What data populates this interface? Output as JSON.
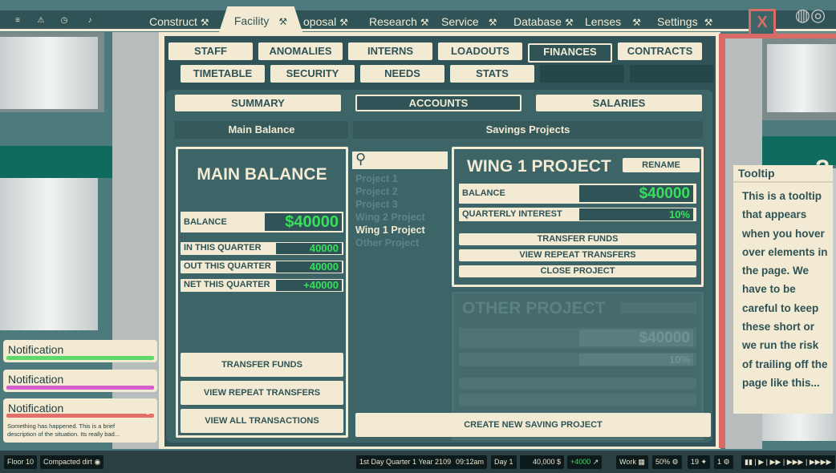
{
  "top_nav": {
    "sys_icons": [
      "menu-icon",
      "warning-icon",
      "clock-icon",
      "bell-icon"
    ],
    "tabs": [
      {
        "label": "Construct",
        "icon": "⚒"
      },
      {
        "label": "Facility",
        "icon": "⚒"
      },
      {
        "label": "oposal",
        "icon": "⚒"
      },
      {
        "label": "Research",
        "icon": "⚒"
      },
      {
        "label": "Service",
        "icon": "⚒"
      },
      {
        "label": "Database",
        "icon": "⚒"
      },
      {
        "label": "Lenses",
        "icon": "⚒"
      },
      {
        "label": "Settings",
        "icon": "⚒"
      }
    ],
    "close_label": "X"
  },
  "sub_tabs_row1": [
    "STAFF",
    "ANOMALIES",
    "INTERNS",
    "LOADOUTS",
    "FINANCES",
    "CONTRACTS"
  ],
  "sub_tabs_row2": [
    "TIMETABLE",
    "SECURITY",
    "NEEDS",
    "STATS"
  ],
  "finance_tabs": [
    "SUMMARY",
    "ACCOUNTS",
    "SALARIES"
  ],
  "sections": {
    "main": "Main Balance",
    "savings": "Savings Projects"
  },
  "main_balance": {
    "title": "MAIN BALANCE",
    "balance_label": "BALANCE",
    "balance_value": "$40000",
    "rows": [
      {
        "label": "IN THIS QUARTER",
        "value": "40000"
      },
      {
        "label": "OUT THIS QUARTER",
        "value": "40000"
      },
      {
        "label": "NET THIS QUARTER",
        "value": "+40000"
      }
    ],
    "buttons": [
      "TRANSFER FUNDS",
      "VIEW REPEAT TRANSFERS",
      "VIEW ALL TRANSACTIONS"
    ]
  },
  "projects": [
    "Project 1",
    "Project 2",
    "Project 3",
    "Wing 2 Project",
    "Wing 1 Project",
    "Other Project"
  ],
  "wing_project": {
    "title": "WING 1 PROJECT",
    "rename": "RENAME",
    "balance_label": "BALANCE",
    "balance_value": "$40000",
    "interest_label": "QUARTERLY INTEREST",
    "interest_value": "10%",
    "buttons": [
      "TRANSFER FUNDS",
      "VIEW REPEAT TRANSFERS",
      "CLOSE PROJECT"
    ]
  },
  "other_project": {
    "title": "OTHER PROJECT",
    "balance_value": "$40000",
    "interest_value": "10%"
  },
  "create_button": "CREATE NEW SAVING PROJECT",
  "tooltip": {
    "title": "Tooltip",
    "body": "This is a tooltip that appears when you hover over elements in the page. We have to be careful to keep these short or we run the risk of trailing off the page like this..."
  },
  "notifications": [
    {
      "title": "Notification",
      "color": "#5fd86a"
    },
    {
      "title": "Notification",
      "color": "#d85fd0"
    },
    {
      "title": "Notification",
      "color": "#e07069",
      "body": "Something has happened.  This is a brief description of the situation. Its really bad..."
    }
  ],
  "status_bar": {
    "floor": "Floor 10",
    "terrain": "Compacted dirt",
    "date": "1st Day Quarter 1 Year 2109",
    "time": "09:12am",
    "day": "Day 1",
    "money": "40,000",
    "money_change": "+4000",
    "mode": "Work",
    "percent": "50%",
    "count1": "19",
    "count2": "1",
    "speeds": [
      "▮▮",
      "▶",
      "▶▶",
      "▶▶▶",
      "▶▶▶▶"
    ]
  }
}
